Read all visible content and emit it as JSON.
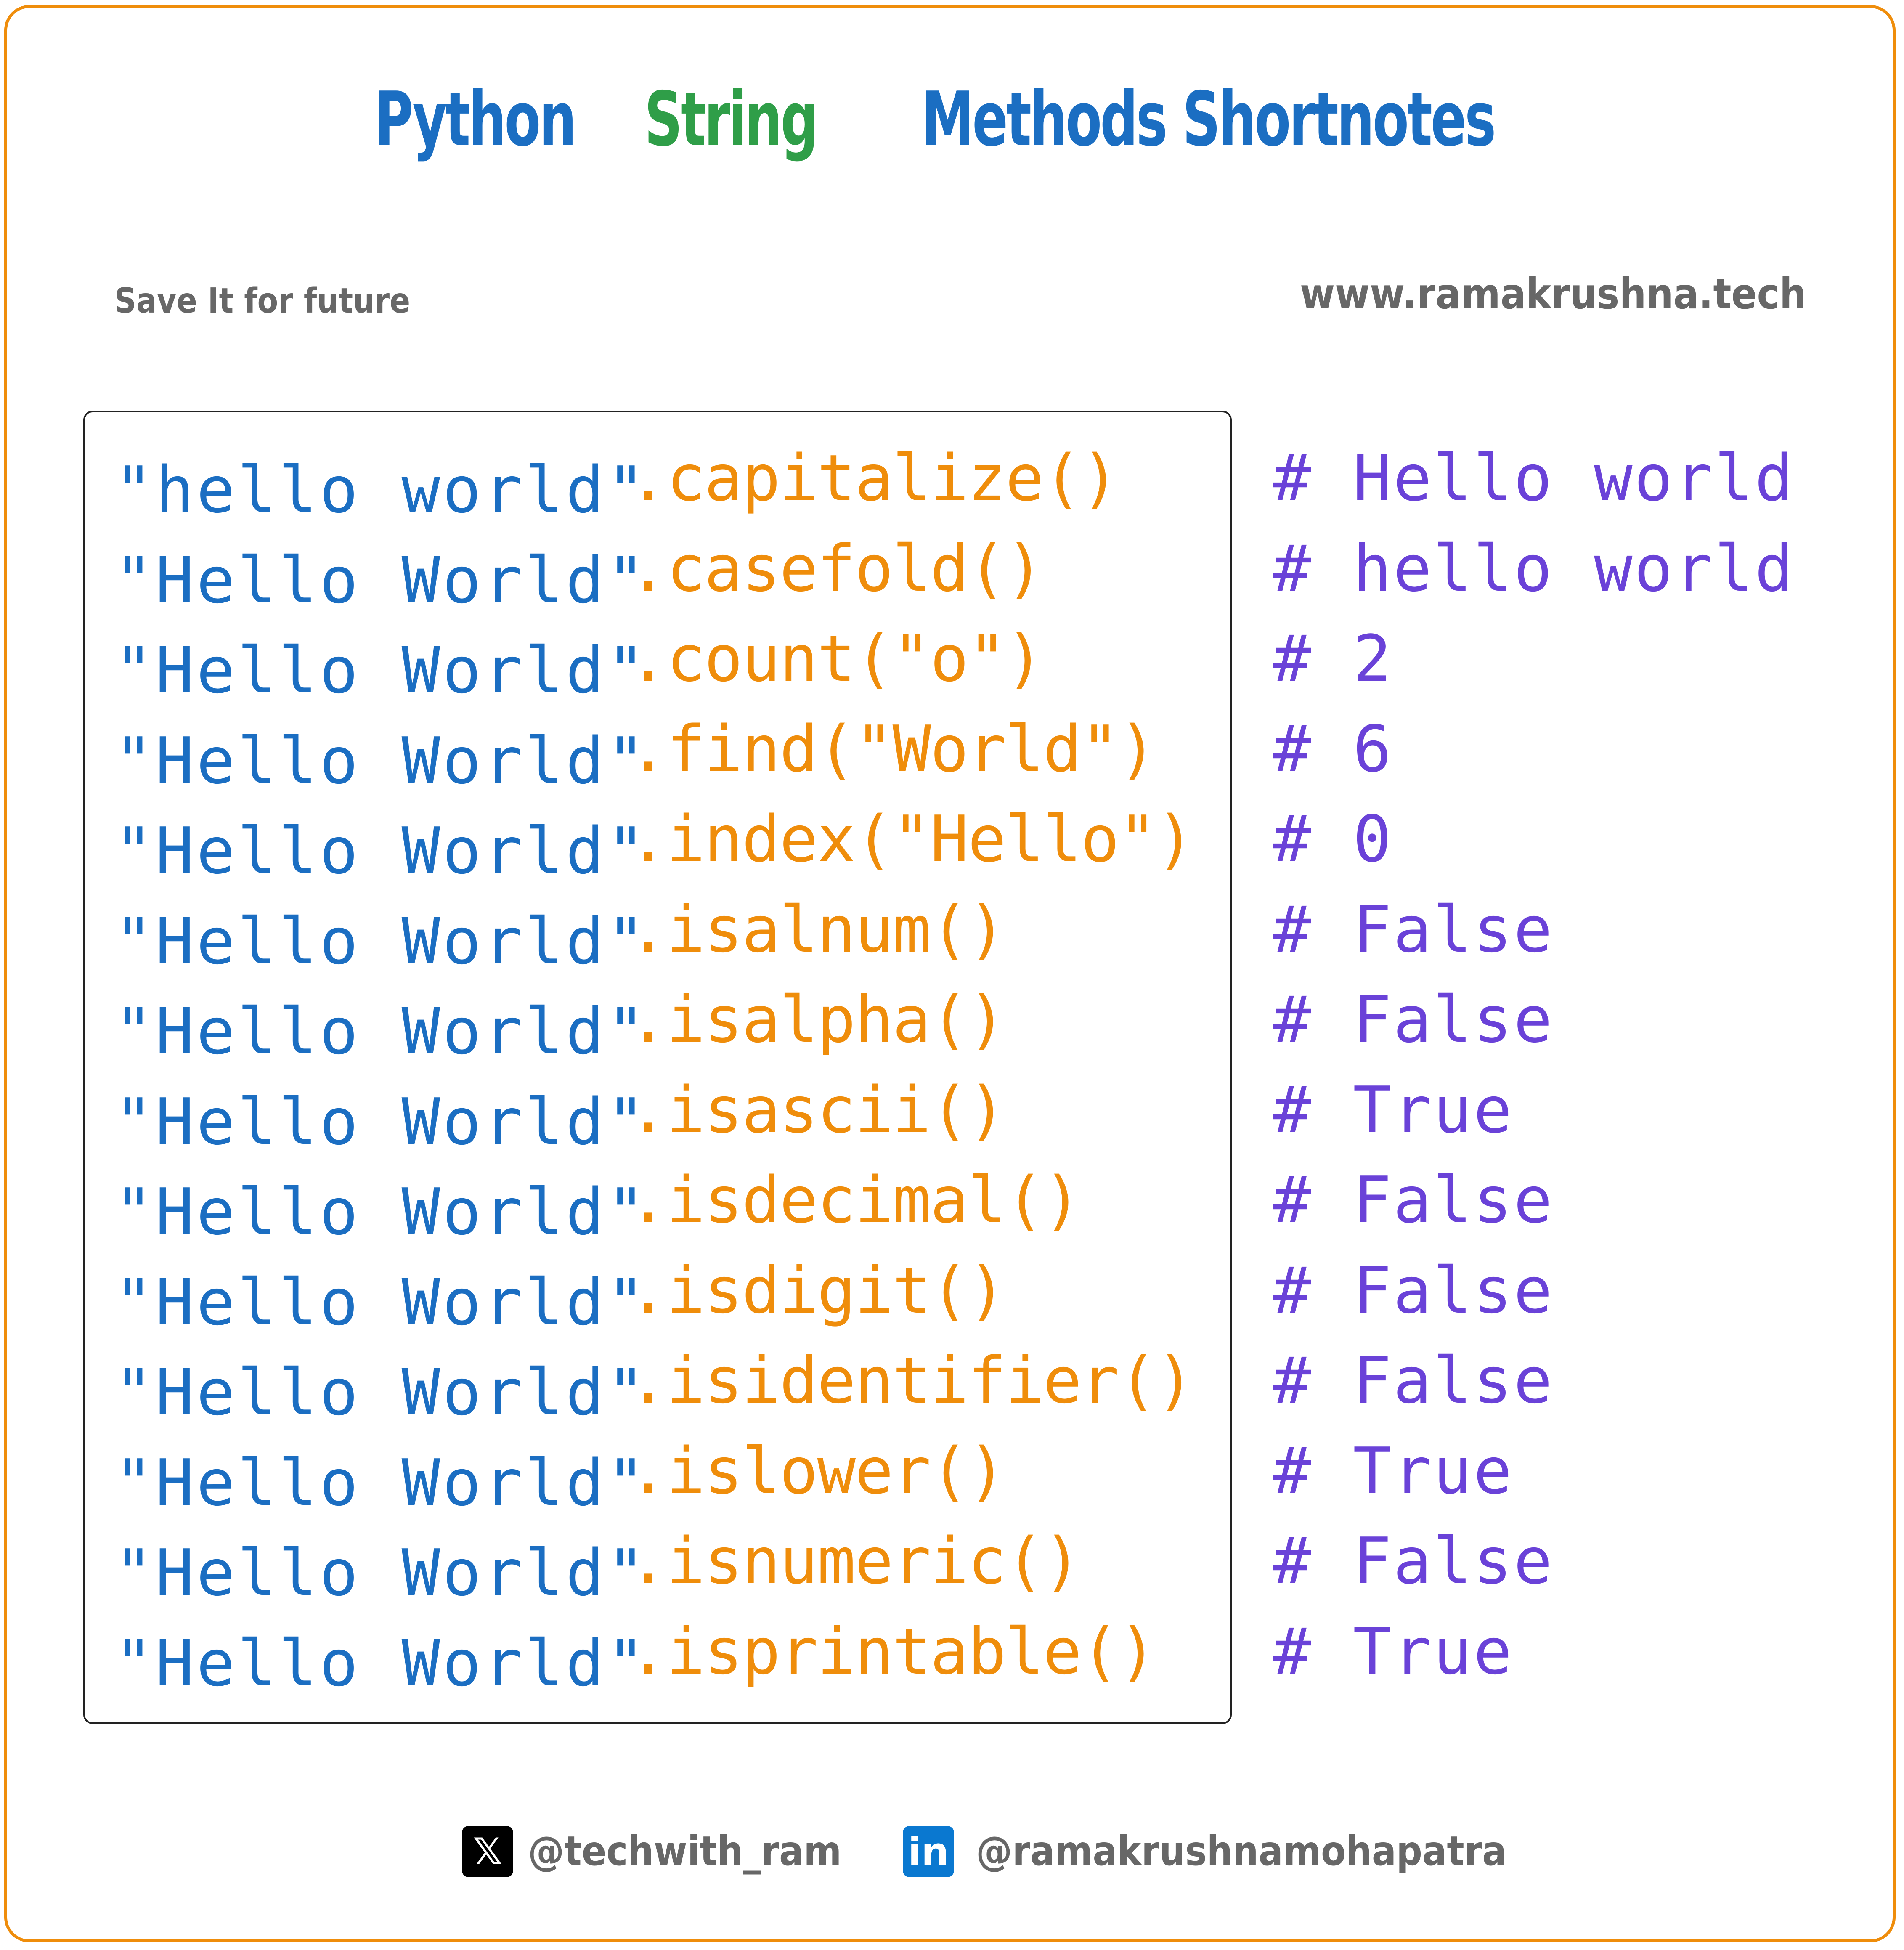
{
  "title": {
    "word1": "Python",
    "word2": "String",
    "word3": "Methods Shortnotes"
  },
  "subheader": {
    "left": "Save It for future",
    "right": "www.ramakrushna.tech"
  },
  "colors": {
    "frame": "#ef8d0b",
    "title_blue": "#1b6ec2",
    "title_green": "#2f9e48",
    "string_literal": "#1b6ec2",
    "method_call": "#ef8d0b",
    "result_comment": "#6a42d8",
    "muted_text": "#676767"
  },
  "examples": [
    {
      "string": "\"hello world\"",
      "method": ".capitalize()",
      "result": "# Hello world"
    },
    {
      "string": "\"Hello World\"",
      "method": ".casefold()",
      "result": "# hello world"
    },
    {
      "string": "\"Hello World\"",
      "method": ".count(\"o\")",
      "result": "# 2"
    },
    {
      "string": "\"Hello World\"",
      "method": ".find(\"World\")",
      "result": "# 6"
    },
    {
      "string": "\"Hello World\"",
      "method": ".index(\"Hello\")",
      "result": "# 0"
    },
    {
      "string": "\"Hello World\"",
      "method": ".isalnum()",
      "result": "# False"
    },
    {
      "string": "\"Hello World\"",
      "method": ".isalpha()",
      "result": "# False"
    },
    {
      "string": "\"Hello World\"",
      "method": ".isascii()",
      "result": "# True"
    },
    {
      "string": "\"Hello World\"",
      "method": ".isdecimal()",
      "result": "# False"
    },
    {
      "string": "\"Hello World\"",
      "method": ".isdigit()",
      "result": "# False"
    },
    {
      "string": "\"Hello World\"",
      "method": ".isidentifier()",
      "result": "# False"
    },
    {
      "string": "\"Hello World\"",
      "method": ".islower()",
      "result": "# True"
    },
    {
      "string": "\"Hello World\"",
      "method": ".isnumeric()",
      "result": "# False"
    },
    {
      "string": "\"Hello World\"",
      "method": ".isprintable()",
      "result": "# True"
    }
  ],
  "footer": {
    "x_icon": "x-logo-icon",
    "x_glyph": "𝕏",
    "x_handle": "@techwith_ram",
    "linkedin_icon": "linkedin-logo-icon",
    "linkedin_glyph": "in",
    "linkedin_handle": "@ramakrushnamohapatra"
  }
}
